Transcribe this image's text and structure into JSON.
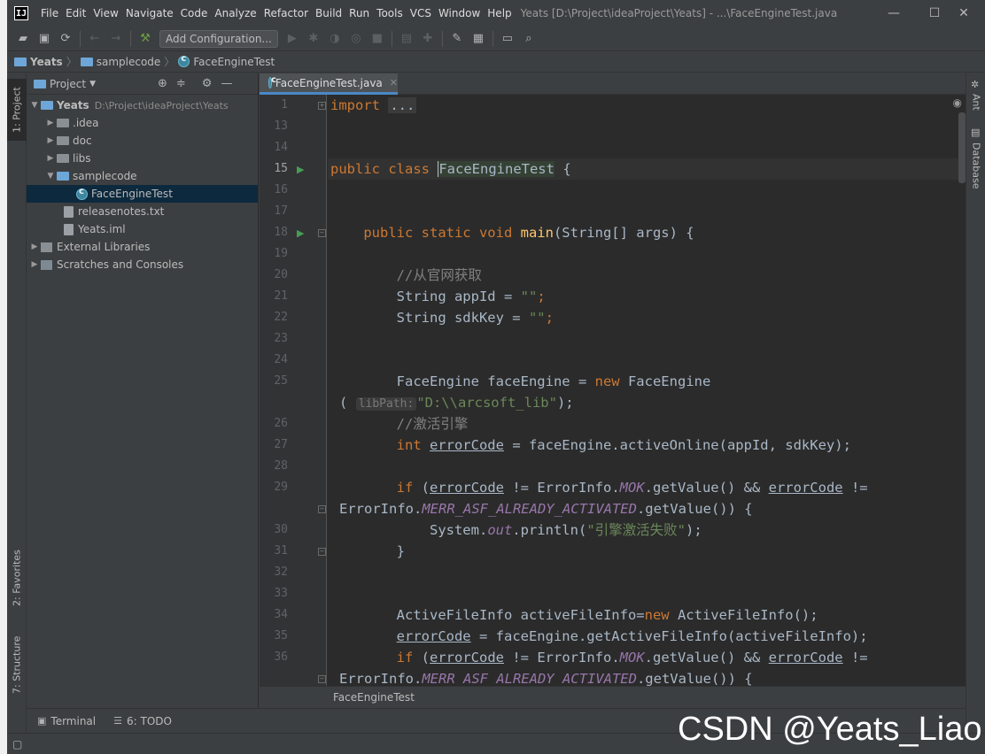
{
  "window": {
    "logo": "IJ",
    "menus": [
      "File",
      "Edit",
      "View",
      "Navigate",
      "Code",
      "Analyze",
      "Refactor",
      "Build",
      "Run",
      "Tools",
      "VCS",
      "Window",
      "Help"
    ],
    "title": "Yeats [D:\\Project\\ideaProject\\Yeats] - ...\\FaceEngineTest.java",
    "controls": {
      "minimize": "—",
      "maximize": "☐",
      "close": "✕"
    }
  },
  "toolbar": {
    "add_config_label": "Add Configuration..."
  },
  "navbar": {
    "crumbs": [
      "Yeats",
      "samplecode",
      "FaceEngineTest"
    ]
  },
  "left_stripe": {
    "project_tab": "1: Project",
    "favorites_tab": "2: Favorites",
    "structure_tab": "7: Structure"
  },
  "right_stripe": {
    "ant_tab": "Ant",
    "database_tab": "Database"
  },
  "project_panel": {
    "title": "Project",
    "tree": [
      {
        "label": "Yeats",
        "path": "D:\\Project\\ideaProject\\Yeats"
      },
      {
        "label": ".idea"
      },
      {
        "label": "doc"
      },
      {
        "label": "libs"
      },
      {
        "label": "samplecode"
      },
      {
        "label": "FaceEngineTest"
      },
      {
        "label": "releasenotes.txt"
      },
      {
        "label": "Yeats.iml"
      },
      {
        "label": "External Libraries"
      },
      {
        "label": "Scratches and Consoles"
      }
    ]
  },
  "editor": {
    "tab_label": "FaceEngineTest.java",
    "line_numbers": [
      "1",
      "13",
      "14",
      "15",
      "16",
      "17",
      "18",
      "19",
      "20",
      "21",
      "22",
      "23",
      "24",
      "25",
      "26",
      "27",
      "28",
      "29",
      "30",
      "31",
      "32",
      "33",
      "34",
      "35",
      "36"
    ],
    "breadcrumb": "FaceEngineTest",
    "code": {
      "l1_kw": "import",
      "l1_dots": "...",
      "l15_kw": "public class ",
      "l15_name": "FaceEngineTest",
      "l15_rest": " {",
      "l18_kw": "public static void ",
      "l18_fn": "main",
      "l18_rest": "(String[] args) {",
      "l20": "//从官网获取",
      "l21_a": "String appId = ",
      "l21_s": "\"\"",
      "l21_b": ";",
      "l22_a": "String sdkKey = ",
      "l22_s": "\"\"",
      "l22_b": ";",
      "l25_a": "FaceEngine faceEngine = ",
      "l25_kw": "new",
      "l25_b": " FaceEngine",
      "l25w_a": "(",
      "l25w_hint": "libPath:",
      "l25w_s": "\"D:\\\\arcsoft_lib\"",
      "l25w_b": ");",
      "l26": "//激活引擎",
      "l27_kw": "int ",
      "l27_v": "errorCode",
      "l27_b": " = faceEngine.activeOnline(appId, sdkKey);",
      "l29_kw": "if",
      "l29_a": " (",
      "l29_v": "errorCode",
      "l29_b": " != ErrorInfo.",
      "l29_st": "MOK",
      "l29_c": ".getValue() && ",
      "l29_v2": "errorCode",
      "l29_d": " !=",
      "l29w_a": "ErrorInfo.",
      "l29w_st": "MERR_ASF_ALREADY_ACTIVATED",
      "l29w_b": ".getValue()) {",
      "l30_a": "System.",
      "l30_st": "out",
      "l30_b": ".println(",
      "l30_s": "\"引擎激活失败\"",
      "l30_c": ");",
      "l31": "}",
      "l34_a": "ActiveFileInfo activeFileInfo=",
      "l34_kw": "new",
      "l34_b": " ActiveFileInfo();",
      "l35_v": "errorCode",
      "l35_b": " = faceEngine.getActiveFileInfo(activeFileInfo);",
      "l36_kw": "if",
      "l36_a": " (",
      "l36_v": "errorCode",
      "l36_b": " != ErrorInfo.",
      "l36_st": "MOK",
      "l36_c": ".getValue() && ",
      "l36_v2": "errorCode",
      "l36_d": " !=",
      "l36w_a": "ErrorInfo.",
      "l36w_st": "MERR_ASF_ALREADY_ACTIVATED",
      "l36w_b": ".getValue()) {"
    }
  },
  "bottom_tabs": {
    "terminal": "Terminal",
    "todo": "6: TODO"
  },
  "watermark": "CSDN @Yeats_Liao"
}
